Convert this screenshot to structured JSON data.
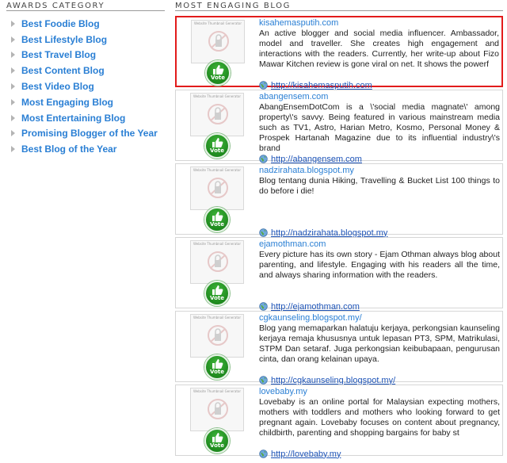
{
  "awards": {
    "heading": "AWARDS CATEGORY",
    "items": [
      {
        "label": "Best Foodie Blog"
      },
      {
        "label": "Best Lifestyle Blog"
      },
      {
        "label": "Best Travel Blog"
      },
      {
        "label": "Best Content Blog"
      },
      {
        "label": "Best Video Blog"
      },
      {
        "label": "Most Engaging Blog"
      },
      {
        "label": "Most Entertaining Blog"
      },
      {
        "label": "Promising Blogger of the Year"
      },
      {
        "label": "Best Blog of the Year"
      }
    ]
  },
  "engaging": {
    "heading": "MOST ENGAGING BLOG",
    "thumb_caption": "Website Thumbnail Generator",
    "vote_label": "Vote",
    "colors": {
      "accent_link": "#2a7fd4",
      "highlight_border": "#e21b1b",
      "vote_green": "#2a9a2a"
    },
    "blogs": [
      {
        "name": "kisahemasputih.com",
        "description": "An active blogger and social media influencer. Ambassador, model and traveller. She creates high engagement and interactions with the readers. Currently, her write-up about Fizo Mawar Kitchen review is gone viral on net. It shows the powerf",
        "url": "http://kisahemasputih.com",
        "highlighted": true
      },
      {
        "name": "abangensem.com",
        "description": "AbangEnsemDotCom is a \\'social media magnate\\' among property\\'s savvy. Being featured in various mainstream media such as TV1, Astro, Harian Metro, Kosmo, Personal Money & Prospek Hartanah Magazine due to its influential industry\\'s brand",
        "url": "http://abangensem.com"
      },
      {
        "name": "nadzirahata.blogspot.my",
        "description": "Blog tentang dunia Hiking, Travelling & Bucket List 100 things to do before i die!",
        "url": "http://nadzirahata.blogspot.my"
      },
      {
        "name": "ejamothman.com",
        "description": "Every picture has its own story - Ejam Othman always blog about parenting, and lifestyle. Engaging with his readers all the time, and always sharing information with the readers.",
        "url": "http://ejamothman.com"
      },
      {
        "name": "cgkaunseling.blogspot.my/",
        "description": "Blog yang memaparkan halatuju kerjaya, perkongsian kaunseling kerjaya remaja khususnya untuk lepasan PT3, SPM, Matrikulasi, STPM Dan setaraf. Juga perkongsian keibubapaan, pengurusan cinta, dan orang kelainan upaya.",
        "url": "http://cgkaunseling.blogspot.my/"
      },
      {
        "name": "lovebaby.my",
        "description": "Lovebaby is an online portal for Malaysian expecting mothers, mothers with toddlers and mothers who looking forward to get pregnant again. Lovebaby focuses on content about pregnancy, childbirth, parenting and shopping bargains for baby st",
        "url": "http://lovebaby.my"
      }
    ]
  }
}
